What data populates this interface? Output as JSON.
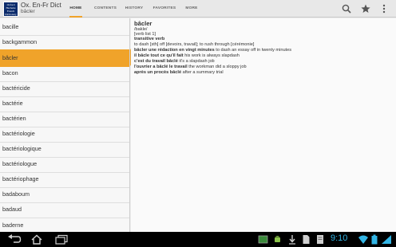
{
  "app": {
    "title": "Ox. En-Fr Dict",
    "subtitle": "bâcler",
    "logo_lines": [
      "Oxford",
      "Hachette",
      "French",
      "Dictionary"
    ]
  },
  "tabs": [
    {
      "label": "HOME",
      "active": true
    },
    {
      "label": "CONTENTS",
      "active": false
    },
    {
      "label": "HISTORY",
      "active": false
    },
    {
      "label": "FAVORITES",
      "active": false
    },
    {
      "label": "MORE",
      "active": false
    }
  ],
  "actions": [
    "search-icon",
    "star-icon",
    "overflow-menu-icon"
  ],
  "wordlist": [
    "bacille",
    "backgammon",
    "bâcler",
    "bacon",
    "bactéricide",
    "bactérie",
    "bactérien",
    "bactériologie",
    "bactériologique",
    "bactériologue",
    "bactériophage",
    "badaboum",
    "badaud",
    "baderne"
  ],
  "selected_word": "bâcler",
  "entry": {
    "headword": "bâcler",
    "pronunciation": "/bakle/",
    "verb_list": "[verb list 1]",
    "pos": "transitive verb",
    "sense_1": "to dash [sth] off [devoirs, travail]; to rush through [cérémonie]",
    "ex1_fr": "bâcler une rédaction en vingt minutes",
    "ex1_en": "to dash an essay off in twenty minutes",
    "ex2_fr": "il bâcle tout ce qu'il fait",
    "ex2_en": "his work is always slapdash",
    "ex3_fr": "c'est du travail bâclé",
    "ex3_en": "it's a slapdash job",
    "ex4_fr": "l'ouvrier a bâclé le travail",
    "ex4_en": "the workman did a sloppy job",
    "ex5_fr": "après un procès bâclé",
    "ex5_en": "after a summary trial"
  },
  "status": {
    "clock": "9:10"
  },
  "colors": {
    "accent": "#f0a32a",
    "headword": "#1c55a3",
    "pos": "#d98a1d",
    "clock": "#33b5e5"
  }
}
